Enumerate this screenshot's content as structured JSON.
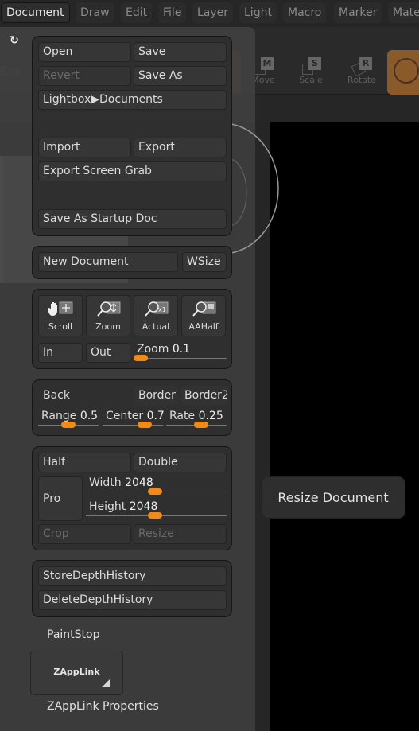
{
  "menubar": {
    "tabs": [
      {
        "label": "Document",
        "active": true
      },
      {
        "label": "Draw",
        "active": false
      },
      {
        "label": "Edit",
        "active": false
      },
      {
        "label": "File",
        "active": false
      },
      {
        "label": "Layer",
        "active": false
      },
      {
        "label": "Light",
        "active": false
      },
      {
        "label": "Macro",
        "active": false
      },
      {
        "label": "Marker",
        "active": false
      },
      {
        "label": "Mate",
        "active": false
      }
    ]
  },
  "background": {
    "box_label": "Box",
    "tools": [
      {
        "key": "M",
        "label": "Move"
      },
      {
        "key": "S",
        "label": "Scale"
      },
      {
        "key": "R",
        "label": "Rotate"
      }
    ]
  },
  "palette": {
    "refresh_icon": "refresh-icon",
    "file_group": {
      "open": "Open",
      "save": "Save",
      "revert": "Revert",
      "save_as": "Save As",
      "lightbox": "Lightbox▶Documents",
      "import": "Import",
      "export": "Export",
      "export_screen_grab": "Export Screen Grab",
      "save_as_startup": "Save As Startup Doc"
    },
    "new_group": {
      "new_document": "New Document",
      "wsize": "WSize"
    },
    "view_group": {
      "icon_buttons": [
        {
          "label": "Scroll",
          "icon": "hand-scroll-icon"
        },
        {
          "label": "Zoom",
          "icon": "magnifier-zoom-icon"
        },
        {
          "label": "Actual",
          "icon": "magnifier-actual-icon"
        },
        {
          "label": "AAHalf",
          "icon": "magnifier-aahalf-icon"
        }
      ],
      "in": "In",
      "out": "Out",
      "zoom_slider": {
        "label": "Zoom",
        "value": "0.1",
        "fraction": 0.03
      }
    },
    "back_group": {
      "back": "Back",
      "border": "Border",
      "border2": "Border2",
      "range": {
        "label": "Range",
        "value": "0.5",
        "fraction": 0.5
      },
      "center": {
        "label": "Center",
        "value": "0.7",
        "fraction": 0.7
      },
      "rate": {
        "label": "Rate",
        "value": "0.25",
        "fraction": 0.58
      }
    },
    "size_group": {
      "half": "Half",
      "double": "Double",
      "pro": "Pro",
      "width": {
        "label": "Width",
        "value": "2048",
        "fraction": 0.49
      },
      "height": {
        "label": "Height",
        "value": "2048",
        "fraction": 0.49
      },
      "crop": "Crop",
      "resize": "Resize"
    },
    "depth_group": {
      "store": "StoreDepthHistory",
      "delete": "DeleteDepthHistory"
    },
    "paintstop": "PaintStop",
    "zapplink": "ZAppLink",
    "zapplink_properties": "ZAppLink Properties"
  },
  "tooltip": {
    "text": "Resize Document"
  },
  "colors": {
    "accent_orange": "#f08a1a",
    "panel_bg": "#404040",
    "group_bg": "#2f2f2f"
  }
}
